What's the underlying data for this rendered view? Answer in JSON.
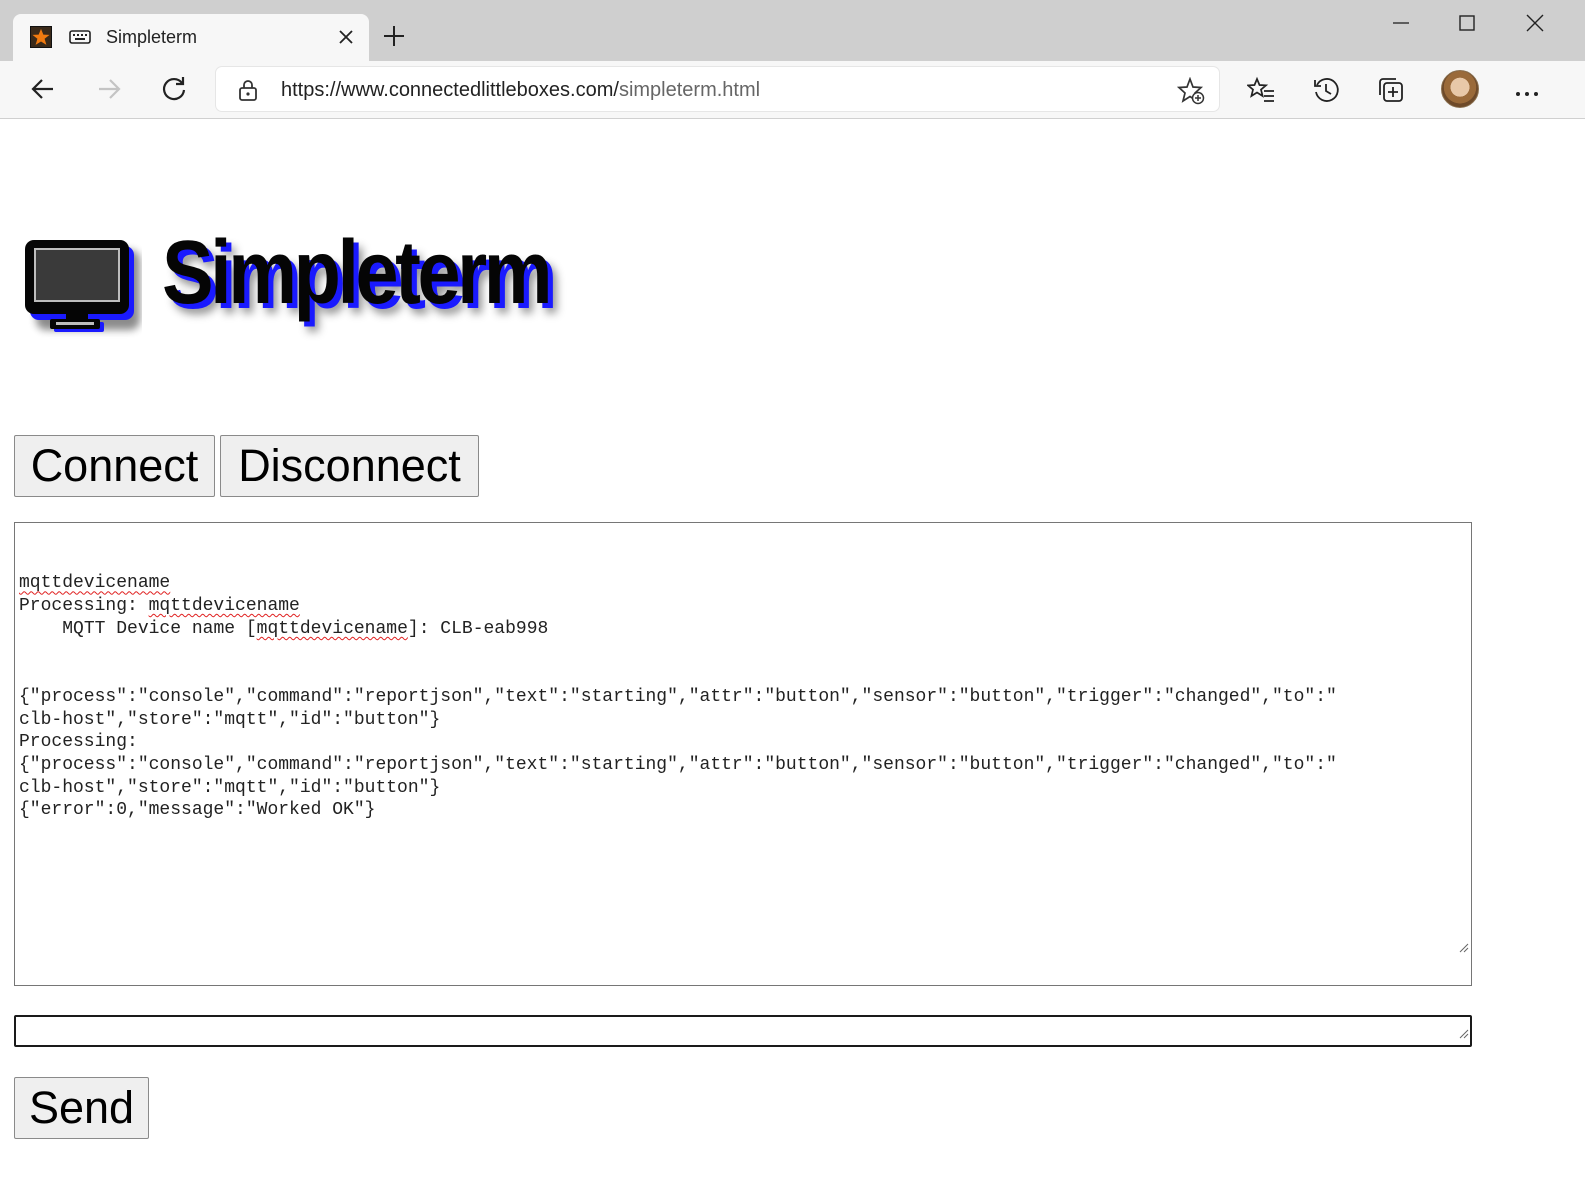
{
  "browser": {
    "tab_title": "Simpleterm",
    "url_host": "https://www.connectedlittleboxes.com/",
    "url_path": "simpleterm.html"
  },
  "page": {
    "logo_text": "Simpleterm",
    "connect_label": "Connect",
    "disconnect_label": "Disconnect",
    "send_label": "Send",
    "console_lines": [
      [
        {
          "t": "mqttdevicename",
          "sq": true
        }
      ],
      [
        {
          "t": "Processing: "
        },
        {
          "t": "mqttdevicename",
          "sq": true
        }
      ],
      [
        {
          "t": "    MQTT Device name ["
        },
        {
          "t": "mqttdevicename",
          "sq": true
        },
        {
          "t": "]: CLB-eab998"
        }
      ],
      [
        {
          "t": ""
        }
      ],
      [
        {
          "t": ""
        }
      ],
      [
        {
          "t": "{\"process\":\"console\",\"command\":\"reportjson\",\"text\":\"starting\",\"attr\":\"button\",\"sensor\":\"button\",\"trigger\":\"changed\",\"to\":\""
        }
      ],
      [
        {
          "t": "clb-host\",\"store\":\"mqtt\",\"id\":\"button\"}"
        }
      ],
      [
        {
          "t": "Processing:"
        }
      ],
      [
        {
          "t": "{\"process\":\"console\",\"command\":\"reportjson\",\"text\":\"starting\",\"attr\":\"button\",\"sensor\":\"button\",\"trigger\":\"changed\",\"to\":\""
        }
      ],
      [
        {
          "t": "clb-host\",\"store\":\"mqtt\",\"id\":\"button\"}"
        }
      ],
      [
        {
          "t": "{\"error\":0,\"message\":\"Worked OK\"}"
        }
      ]
    ],
    "command_value": ""
  }
}
